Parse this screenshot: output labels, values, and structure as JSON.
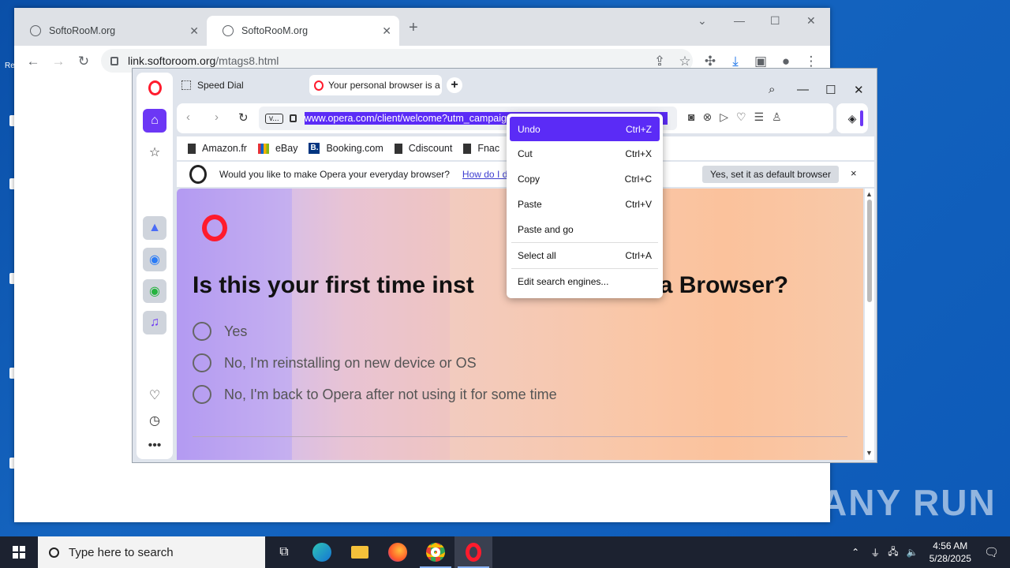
{
  "chrome": {
    "tabs": [
      {
        "title": "SoftoRooM.org",
        "active": false
      },
      {
        "title": "SoftoRooM.org",
        "active": true
      }
    ],
    "new_tab": "+",
    "omnibox": {
      "host": "link.softoroom.org",
      "path": "/mtags8.html"
    }
  },
  "opera": {
    "tabs": [
      {
        "title": "Speed Dial"
      },
      {
        "title": "Your personal browser is a"
      }
    ],
    "address": {
      "site_badge": "v...",
      "url": "www.opera.com/client/welcome?utm_campaign=...&utm_source=...&utm"
    },
    "bookmarks": [
      {
        "label": "Amazon.fr",
        "icon": "page-icon"
      },
      {
        "label": "eBay",
        "icon": "ebay-icon"
      },
      {
        "label": "Booking.com",
        "icon": "booking-icon"
      },
      {
        "label": "Cdiscount",
        "icon": "page-icon"
      },
      {
        "label": "Fnac",
        "icon": "page-icon"
      }
    ],
    "infobar": {
      "question": "Would you like to make Opera your everyday browser?",
      "link": "How do I d",
      "button": "Yes, set it as default browser",
      "close": "×"
    },
    "page": {
      "heading": "Is this your first time inst",
      "heading_tail": "a Browser?",
      "options": [
        "Yes",
        "No, I'm reinstalling on new device or OS",
        "No, I'm back to Opera after not using it for some time"
      ]
    }
  },
  "context_menu": {
    "items": [
      {
        "label": "Undo",
        "shortcut": "Ctrl+Z",
        "highlighted": true
      },
      {
        "label": "Cut",
        "shortcut": "Ctrl+X"
      },
      {
        "label": "Copy",
        "shortcut": "Ctrl+C"
      },
      {
        "label": "Paste",
        "shortcut": "Ctrl+V"
      },
      {
        "label": "Paste and go",
        "shortcut": ""
      },
      {
        "label": "Select all",
        "shortcut": "Ctrl+A"
      },
      {
        "label": "Edit search engines...",
        "shortcut": ""
      }
    ]
  },
  "taskbar": {
    "search_placeholder": "Type here to search",
    "time": "4:56 AM",
    "date": "5/28/2025"
  },
  "watermark": "ANY RUN",
  "colors": {
    "opera_red": "#ff1b2d",
    "opera_purple": "#5b2bf6",
    "taskbar": "#1c2230"
  }
}
